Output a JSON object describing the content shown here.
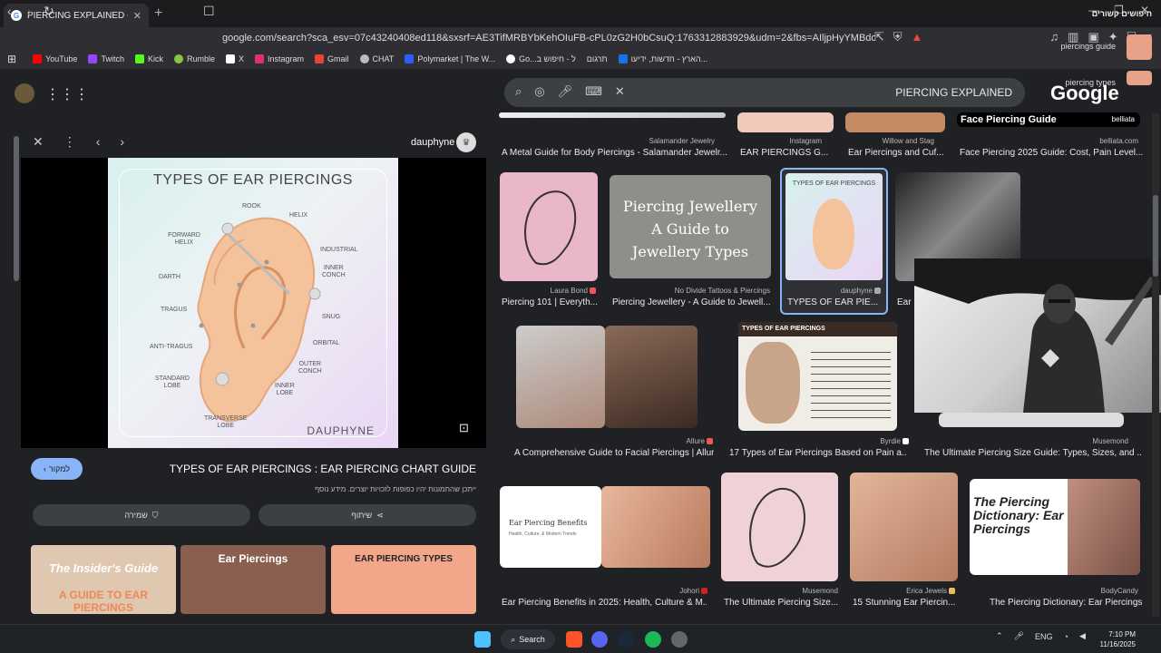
{
  "browser": {
    "tab_title": "PIERCING EXPLAINED - חיפוש ב",
    "url": "google.com/search?sca_esv=07c43240408ed118&sxsrf=AE3TifMRBYbKehOIuFB-cPL0zG2H0bCsuQ:1763312883929&udm=2&fbs=AIljpHyYMBdor7K...",
    "bookmarks": [
      {
        "label": "YouTube",
        "color": "#ff0000"
      },
      {
        "label": "Twitch",
        "color": "#9146ff"
      },
      {
        "label": "Kick",
        "color": "#53fc18"
      },
      {
        "label": "Rumble",
        "color": "#85c742"
      },
      {
        "label": "X",
        "color": "#ffffff"
      },
      {
        "label": "Instagram",
        "color": "#e1306c"
      },
      {
        "label": "Gmail",
        "color": "#ea4335"
      },
      {
        "label": "CHAT",
        "color": "#bbbbbb"
      },
      {
        "label": "Polymarket | The W...",
        "color": "#2e5cff"
      },
      {
        "label": "Go...ל - חיפוש ב",
        "color": "#4285f4"
      },
      {
        "label": "תרגום",
        "color": "#4285f4"
      },
      {
        "label": "הארץ - חדשות, ידיעו...",
        "color": "#1a73e8"
      }
    ]
  },
  "search": {
    "query": "PIERCING EXPLAINED",
    "logo": "Google"
  },
  "preview": {
    "source_name": "dauphyne",
    "image_heading": "TYPES OF EAR PIERCINGS",
    "ear_labels": {
      "rook": "ROOK",
      "helix": "HELIX",
      "forward_helix": "FORWARD\nHELIX",
      "industrial": "INDUSTRIAL",
      "inner_conch": "INNER\nCONCH",
      "darth": "DARTH",
      "tragus": "TRAGUS",
      "snug": "SNUG",
      "anti_tragus": "ANTI-TRAGUS",
      "orbital": "ORBITAL",
      "outer_conch": "OUTER\nCONCH",
      "standard_lobe": "STANDARD\nLOBE",
      "inner_lobe": "INNER\nLOBE",
      "transverse_lobe": "TRANSVERSE\nLOBE",
      "brand": "DAUPHYNE"
    },
    "visit_label": "למקור",
    "title": "TYPES OF EAR PIERCINGS : EAR PIERCING CHART GUIDE",
    "copyright_note": "ייתכן שהתמונות יהיו כפופות לזכויות יוצרים. מידע נוסף",
    "save_label": "שמירה",
    "share_label": "שיתוף",
    "thumbs": [
      {
        "text": "The Insider's Guide",
        "sub": "A GUIDE TO EAR PIERCINGS",
        "color": "#e0c7b0"
      },
      {
        "text": "Ear Piercings",
        "sub": "",
        "color": "#c8968a"
      },
      {
        "text": "EAR PIERCING TYPES",
        "sub": "",
        "color": "#f2a78a"
      }
    ]
  },
  "results": {
    "row0": [
      {
        "source": "Salamander Jewelry",
        "caption": "A Metal Guide for Body Piercings - Salamander Jewelr..."
      },
      {
        "source": "Instagram",
        "caption": "EAR PIERCINGS G..."
      },
      {
        "source": "Willow and Stag",
        "caption": "Ear Piercings and Cuf..."
      },
      {
        "source": "belliata.com",
        "caption": "Face Piercing 2025 Guide: Cost, Pain Level...",
        "image_text": "Face Piercing Guide",
        "image_brand": "belliata"
      }
    ],
    "row1": [
      {
        "source": "Laura Bond",
        "caption": "Piercing 101 | Everyth..."
      },
      {
        "source": "No Divide Tattoos & Piercings",
        "caption": "Piercing Jewellery - A Guide to Jewell...",
        "image_text": "Piercing Jewellery\nA Guide to\nJewellery Types"
      },
      {
        "source": "dauphyne",
        "caption": "TYPES OF EAR PIE...",
        "image_text": "TYPES OF EAR PIERCINGS"
      },
      {
        "source": "",
        "caption": "Ear"
      }
    ],
    "row2": [
      {
        "source": "Allure",
        "caption": "A Comprehensive Guide to Facial Piercings | Allure"
      },
      {
        "source": "Byrdie",
        "caption": "17 Types of Ear Piercings Based on Pain a...",
        "image_text": "TYPES OF EAR PIERCINGS"
      },
      {
        "source": "Musemond",
        "caption": "The Ultimate Piercing Size Guide: Types, Sizes, and ..."
      }
    ],
    "row3": [
      {
        "source": "Johori",
        "caption": "Ear Piercing Benefits in 2025: Health, Culture & M...",
        "image_text": "Ear Piercing Benefits",
        "image_sub": "Health, Culture, & Modern Trends"
      },
      {
        "source": "Musemond",
        "caption": "The Ultimate Piercing Size..."
      },
      {
        "source": "Erica Jewels",
        "caption": "15 Stunning Ear Piercin..."
      },
      {
        "source": "BodyCandy",
        "caption": "The Piercing Dictionary: Ear Piercings",
        "image_text": "The Piercing Dictionary: Ear Piercings"
      }
    ],
    "related_heading": "חיפושים קשורים",
    "related": [
      "piercings guide",
      "piercing types"
    ]
  },
  "taskbar": {
    "search_label": "Search",
    "lang": "ENG",
    "time": "7:10 PM",
    "date": "11/16/2025"
  }
}
